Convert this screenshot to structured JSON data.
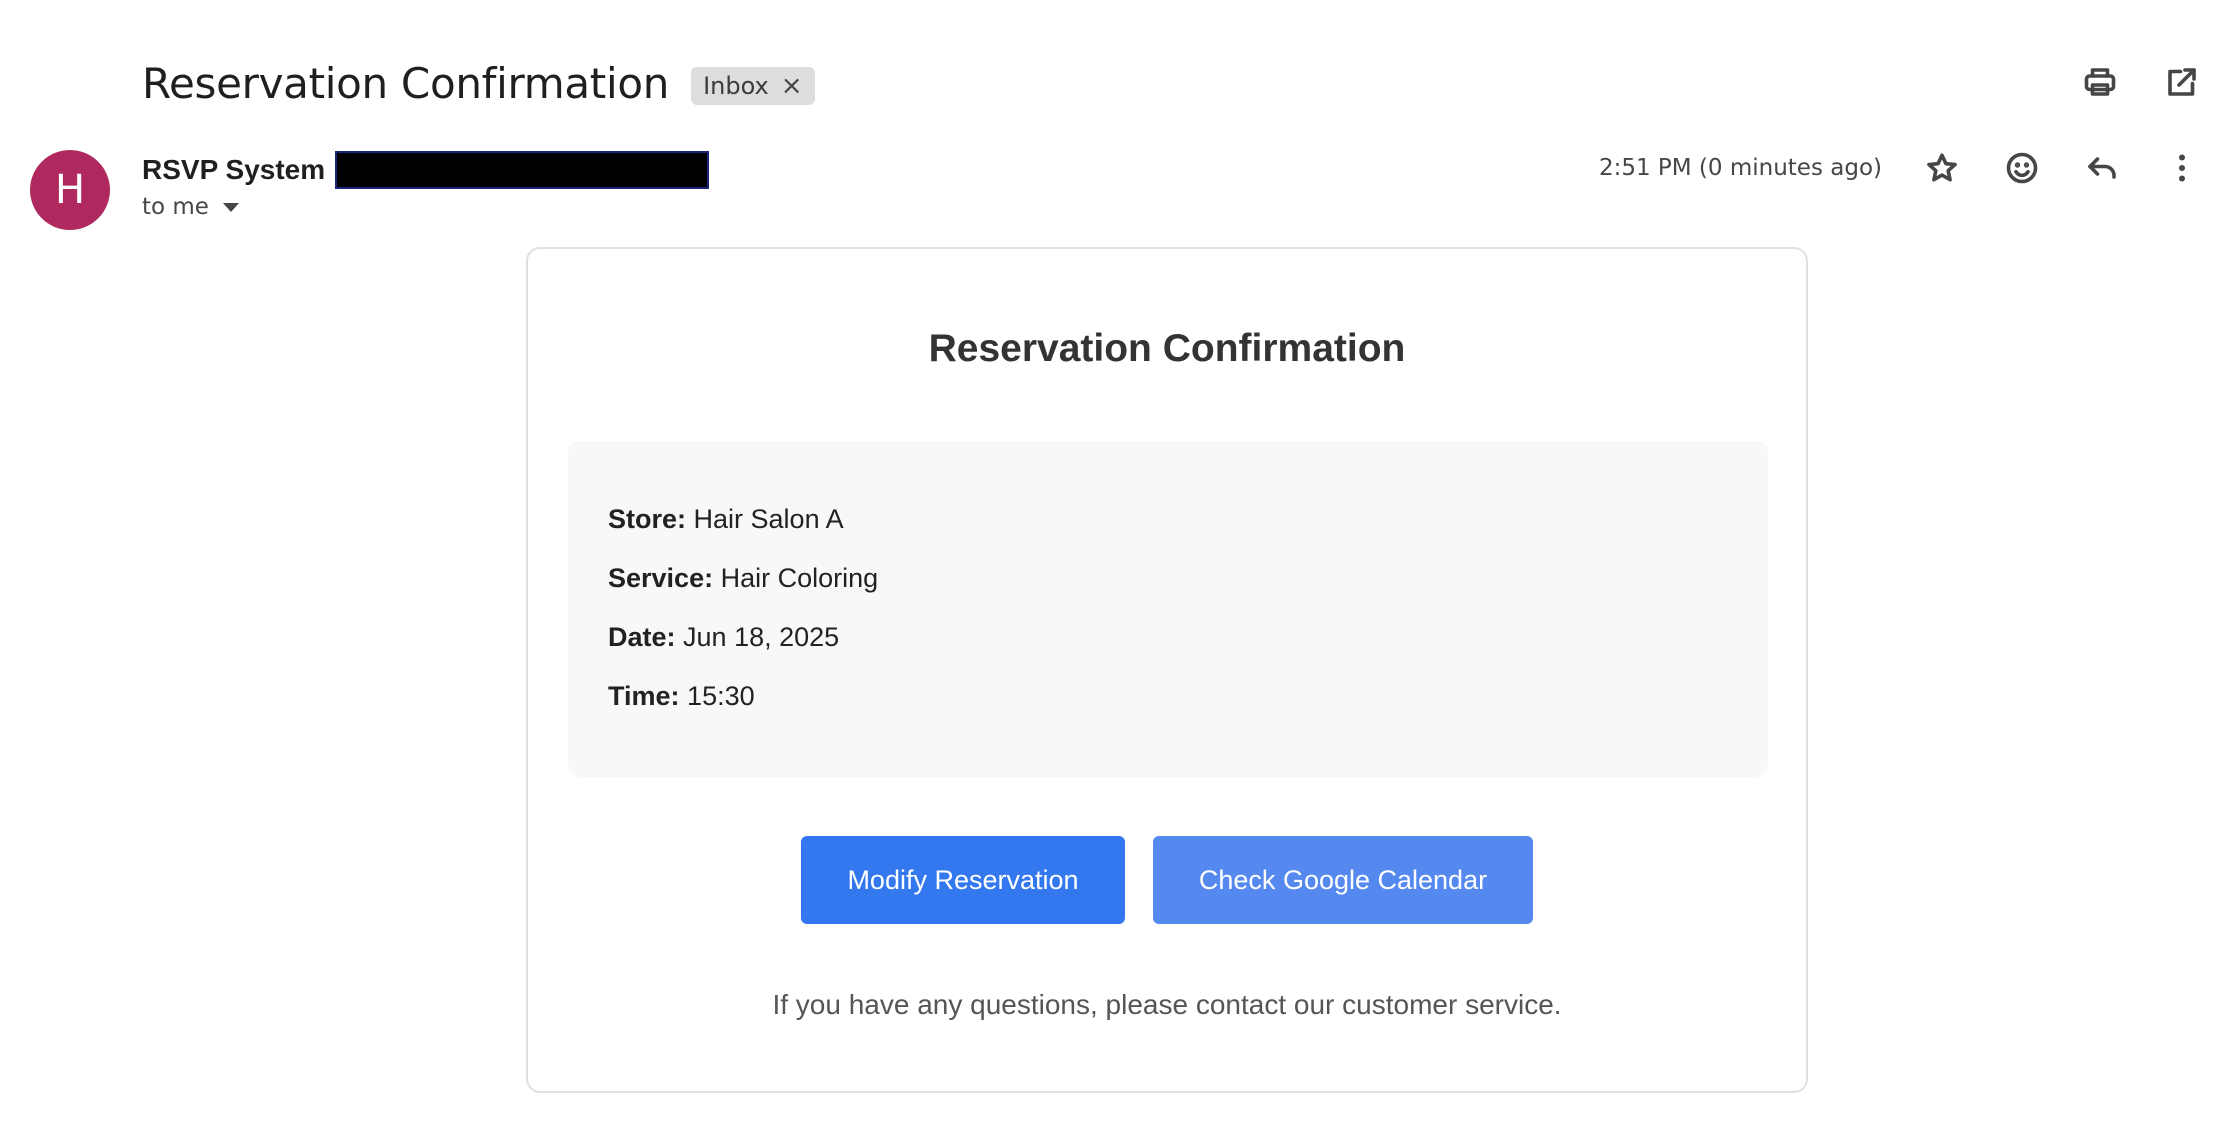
{
  "header": {
    "subject": "Reservation Confirmation",
    "label_chip": "Inbox",
    "label_chip_close": "×",
    "actions": [
      {
        "name": "print-all",
        "icon": "printer-icon"
      },
      {
        "name": "open-in-new-window",
        "icon": "open-external-icon"
      }
    ]
  },
  "sender": {
    "avatar_letter": "H",
    "avatar_color": "#b0295e",
    "name": "RSVP System",
    "email_redacted": true,
    "recipient": "to me",
    "timestamp": "2:51 PM (0 minutes ago)",
    "actions": [
      {
        "name": "star",
        "icon": "star-icon"
      },
      {
        "name": "add-reaction",
        "icon": "emoji-icon"
      },
      {
        "name": "reply",
        "icon": "reply-icon"
      },
      {
        "name": "more",
        "icon": "more-vert-icon"
      }
    ]
  },
  "email_body": {
    "title": "Reservation Confirmation",
    "details": [
      {
        "label": "Store:",
        "value": "Hair Salon A"
      },
      {
        "label": "Service:",
        "value": "Hair Coloring"
      },
      {
        "label": "Date:",
        "value": "Jun 18, 2025"
      },
      {
        "label": "Time:",
        "value": "15:30"
      }
    ],
    "buttons": {
      "modify": "Modify Reservation",
      "calendar": "Check Google Calendar"
    },
    "footer": "If you have any questions, please contact our customer service.",
    "colors": {
      "primary_button": "#3478f0",
      "secondary_button": "#5589f0",
      "details_background": "#f7f8fa"
    }
  }
}
